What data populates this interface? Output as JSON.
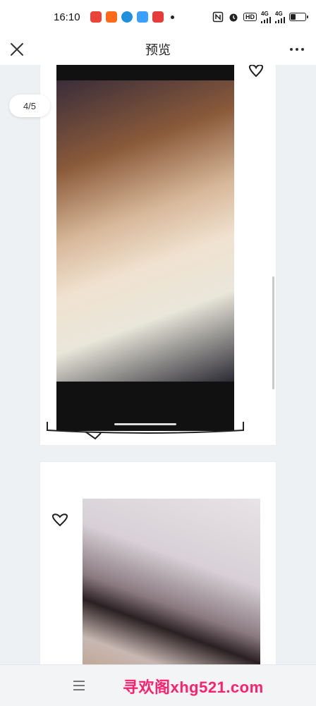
{
  "status_bar": {
    "time": "16:10",
    "network_label_1": "4G",
    "network_label_2": "4G",
    "hd_label": "HD",
    "app_icons": [
      "toutiao-app-icon",
      "taobao-app-icon",
      "edge-browser-icon",
      "qq-browser-icon",
      "wps-app-icon"
    ],
    "icons": [
      "nfc-icon",
      "alarm-icon",
      "hd-voice-icon",
      "signal-icon",
      "wifi-icon",
      "battery-icon"
    ]
  },
  "nav": {
    "title": "预览"
  },
  "viewer": {
    "page_indicator": "4/5"
  },
  "bottom": {
    "watermark": "寻欢阁xhg521.com"
  },
  "colors": {
    "background": "#eef1f4",
    "watermark": "#ff1f6b"
  }
}
